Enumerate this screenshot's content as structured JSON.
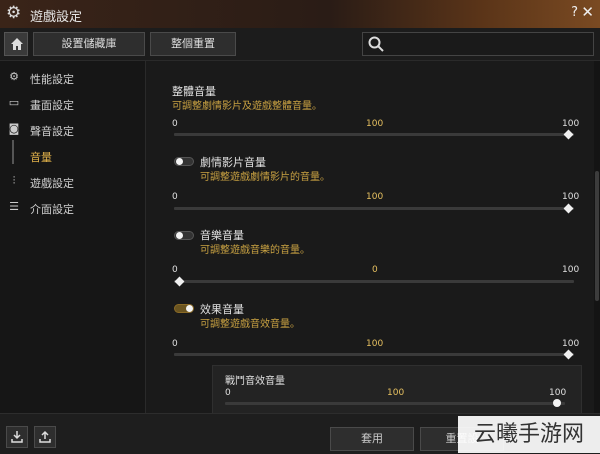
{
  "window": {
    "title": "遊戲設定",
    "help": "?",
    "close": "✕"
  },
  "toolbar": {
    "save_library": "設置儲藏庫",
    "reset_all": "整個重置",
    "search_placeholder": ""
  },
  "sidebar": {
    "items": [
      {
        "label": "性能設定",
        "icon": "performance-icon"
      },
      {
        "label": "畫面設定",
        "icon": "monitor-icon"
      },
      {
        "label": "聲音設定",
        "icon": "speaker-icon"
      },
      {
        "label": "音量",
        "icon": ""
      },
      {
        "label": "遊戲設定",
        "icon": "sliders-icon"
      },
      {
        "label": "介面設定",
        "icon": "interface-icon"
      }
    ]
  },
  "settings": {
    "master": {
      "title": "整體音量",
      "desc": "可調整劇情影片及遊戲整體音量。",
      "min": "0",
      "value_label": "100",
      "max": "100",
      "value": 100
    },
    "cinematic": {
      "title": "劇情影片音量",
      "desc": "可調整遊戲劇情影片的音量。",
      "min": "0",
      "value_label": "100",
      "max": "100",
      "value": 100,
      "enabled": false
    },
    "music": {
      "title": "音樂音量",
      "desc": "可調整遊戲音樂的音量。",
      "min": "0",
      "value_label": "0",
      "max": "100",
      "value": 0,
      "enabled": false
    },
    "effects": {
      "title": "效果音量",
      "desc": "可調整遊戲音效音量。",
      "min": "0",
      "value_label": "100",
      "max": "100",
      "value": 100,
      "enabled": true
    },
    "combat": {
      "title": "戰鬥音效音量",
      "min": "0",
      "value_label": "100",
      "max": "100",
      "value": 100
    }
  },
  "footer": {
    "apply": "套用",
    "reset": "重置設"
  },
  "watermark": "云曦手游网",
  "colors": {
    "accent": "#e3b24a",
    "desc": "#c9a242"
  }
}
